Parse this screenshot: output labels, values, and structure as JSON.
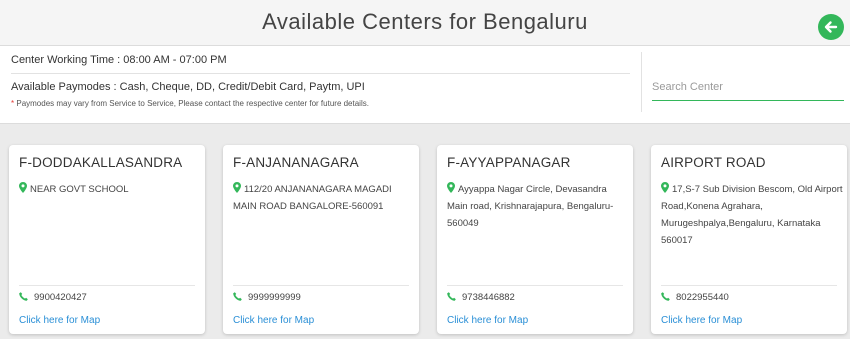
{
  "header": {
    "title": "Available Centers for Bengaluru"
  },
  "info": {
    "working_time": "Center Working Time : 08:00 AM - 07:00 PM",
    "paymodes_label": "Available Paymodes :",
    "paymodes": "Cash, Cheque, DD, Credit/Debit Card, Paytm, UPI",
    "note_star": "*",
    "note": "Paymodes may vary from Service to Service, Please contact the respective center for future details."
  },
  "search": {
    "placeholder": "Search Center",
    "value": ""
  },
  "centers": [
    {
      "name": "F-DODDAKALLASANDRA",
      "address": "NEAR GOVT SCHOOL",
      "phone": "9900420427",
      "map_label": "Click here for Map"
    },
    {
      "name": "F-ANJANANAGARA",
      "address": "112/20 ANJANANAGARA MAGADI MAIN ROAD BANGALORE-560091",
      "phone": "9999999999",
      "map_label": "Click here for Map"
    },
    {
      "name": "F-AYYAPPANAGAR",
      "address": "Ayyappa Nagar Circle, Devasandra Main road, Krishnarajapura, Bengaluru-560049",
      "phone": "9738446882",
      "map_label": "Click here for Map"
    },
    {
      "name": "AIRPORT ROAD",
      "address": "17,S-7 Sub Division Bescom, Old Airport Road,Konena Agrahara, Murugeshpalya,Bengaluru, Karnataka 560017",
      "phone": "8022955440",
      "map_label": "Click here for Map"
    }
  ],
  "colors": {
    "accent_green": "#33b75a",
    "link_blue": "#2a8fd6",
    "note_star_red": "#e53935"
  },
  "icons": {
    "back": "arrow-left-circle",
    "location": "map-pin",
    "phone": "phone"
  }
}
